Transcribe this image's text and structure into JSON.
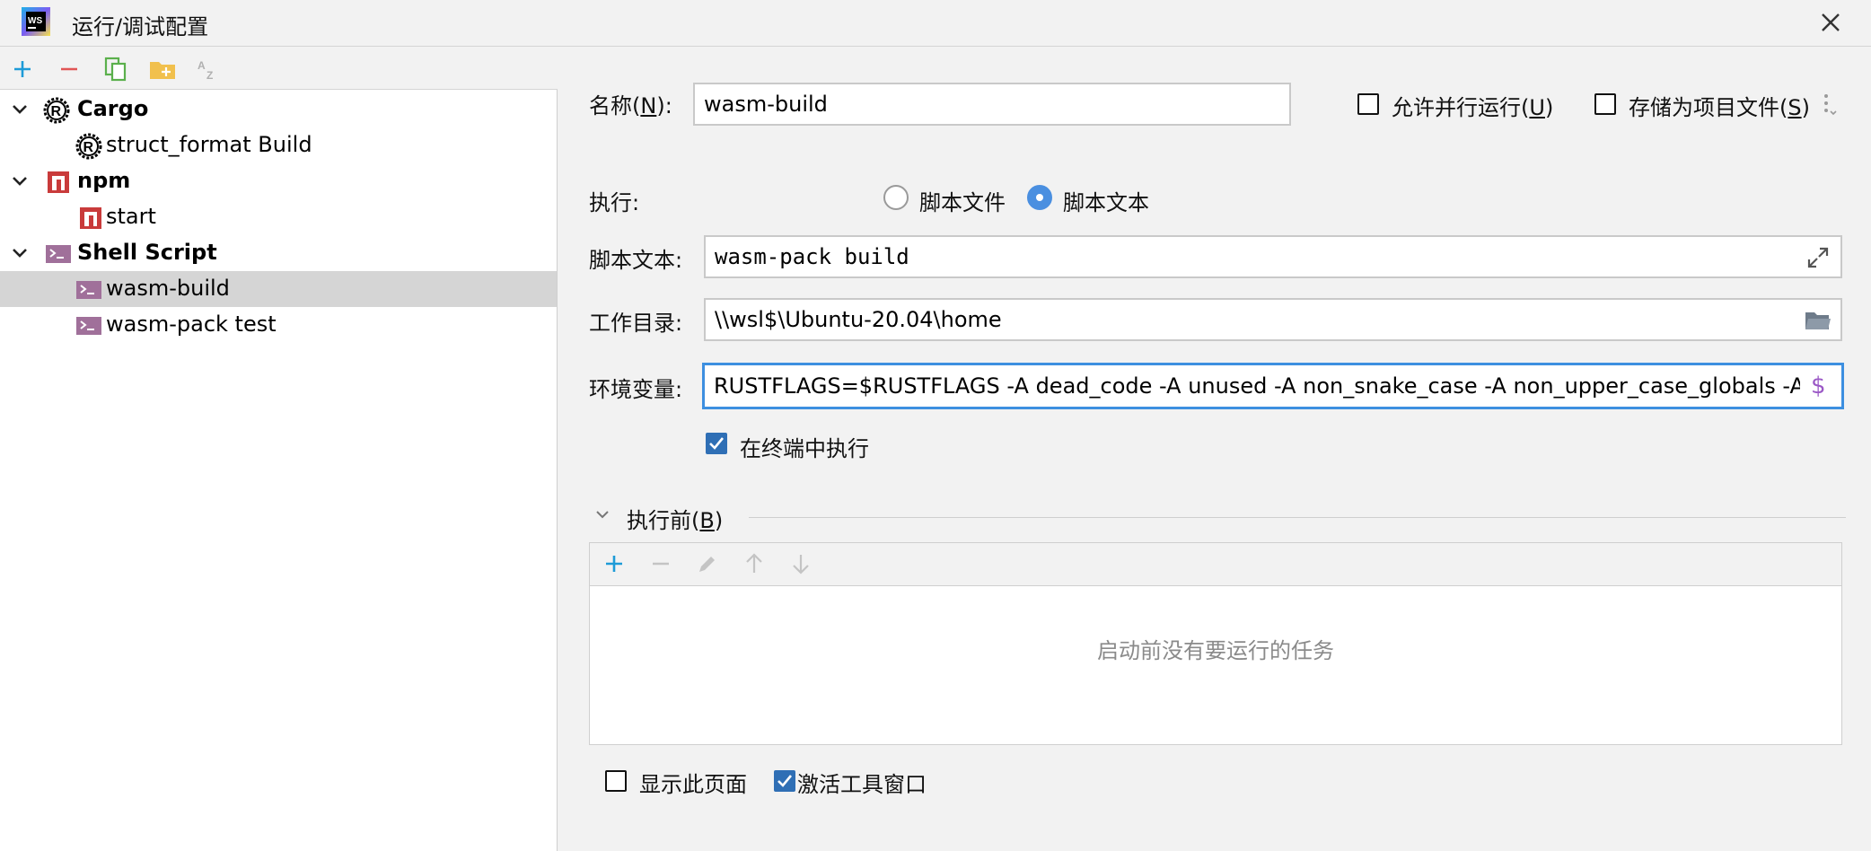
{
  "window": {
    "title": "运行/调试配置"
  },
  "icons": {
    "app": "webstorm-logo-icon",
    "close": "close-icon",
    "add": "plus-icon",
    "remove": "minus-icon",
    "copy": "copy-icon",
    "folder": "new-folder-icon",
    "sort": "sort-alphabetical-icon"
  },
  "tree": {
    "groups": [
      {
        "label": "Cargo",
        "icon": "rust-icon",
        "children": [
          {
            "label": "struct_format Build",
            "icon": "rust-icon"
          }
        ]
      },
      {
        "label": "npm",
        "icon": "npm-icon",
        "children": [
          {
            "label": "start",
            "icon": "npm-icon"
          }
        ]
      },
      {
        "label": "Shell Script",
        "icon": "shell-script-icon",
        "children": [
          {
            "label": "wasm-build",
            "icon": "shell-script-icon",
            "selected": true
          },
          {
            "label": "wasm-pack test",
            "icon": "shell-script-icon"
          }
        ]
      }
    ]
  },
  "form": {
    "name_label_prefix": "名称(",
    "name_label_key": "N",
    "name_label_suffix": "):",
    "name_value": "wasm-build",
    "parallel_prefix": "允许并行运行(",
    "parallel_key": "U",
    "parallel_suffix": ")",
    "store_prefix": "存储为项目文件(",
    "store_key": "S",
    "store_suffix": ")",
    "execute_label": "执行:",
    "radio_file_label": "脚本文件",
    "radio_text_label": "脚本文本",
    "script_text_label": "脚本文本:",
    "script_text_value": "wasm-pack build",
    "workdir_label": "工作目录:",
    "workdir_value": "\\\\wsl$\\Ubuntu-20.04\\home",
    "env_label": "环境变量:",
    "env_value": "RUSTFLAGS=$RUSTFLAGS -A dead_code -A unused -A non_snake_case -A non_upper_case_globals -A nc",
    "env_dollar": "$",
    "run_in_terminal_label": "在终端中执行",
    "run_in_terminal_checked": true
  },
  "before_launch": {
    "title_prefix": "执行前(",
    "title_key": "B",
    "title_suffix": ")",
    "empty_text": "启动前没有要运行的任务"
  },
  "bottom": {
    "show_page_label": "显示此页面",
    "show_page_checked": false,
    "activate_tool_window_label": "激活工具窗口",
    "activate_tool_window_checked": true
  },
  "colors": {
    "accent_blue": "#3d8fe0",
    "add_green_blue": "#1e9bd7",
    "remove_red": "#e05555",
    "folder_yellow": "#f1c04d",
    "shell_purple": "#a0709a",
    "npm_red": "#c93b3b",
    "env_dollar_purple": "#9b59c6"
  }
}
